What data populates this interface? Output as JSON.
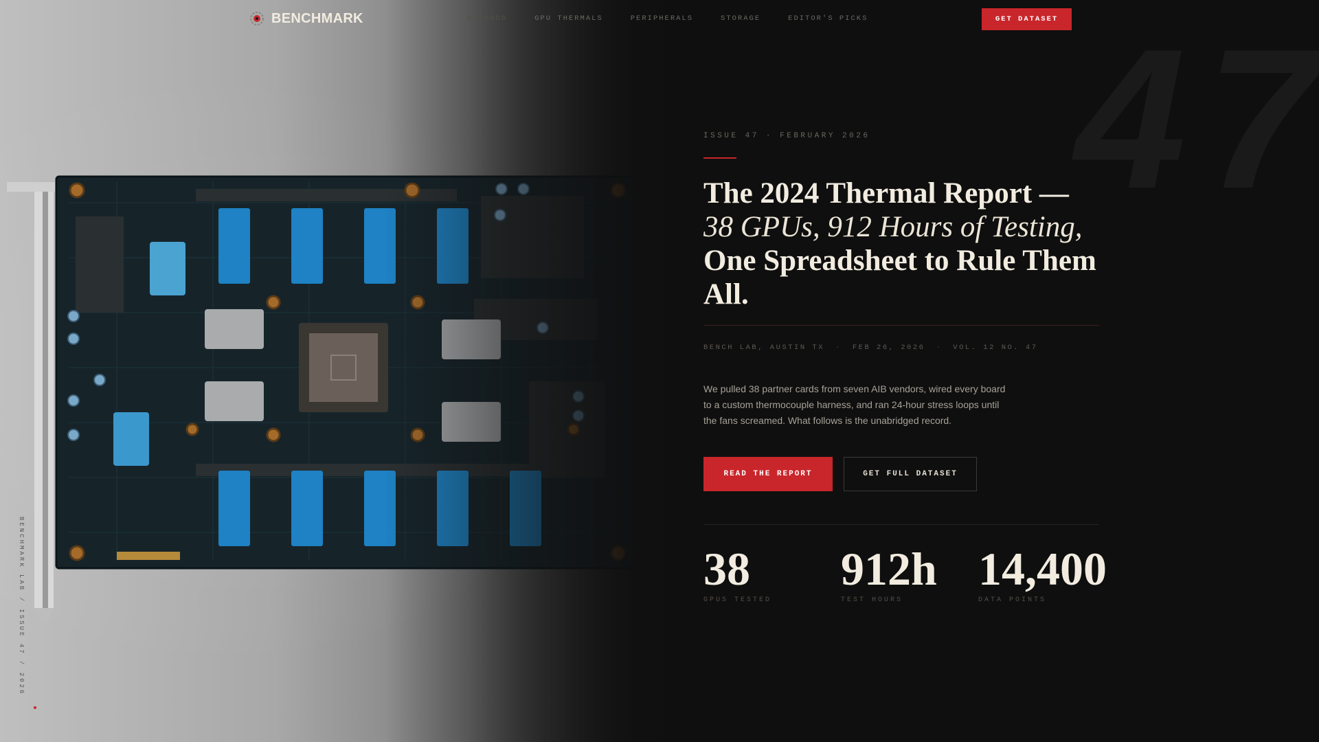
{
  "brand": {
    "name": "BENCHMARK",
    "logo_icon": "gear-chip-icon"
  },
  "nav": {
    "links": [
      "Methods",
      "GPU Thermals",
      "Peripherals",
      "Storage",
      "Editor's Picks"
    ],
    "cta_label": "Get Dataset"
  },
  "watermark": "47",
  "hero": {
    "kicker": "Issue 47 · February 2026",
    "headline_line1": "The 2024 Thermal Report —",
    "headline_line2": "38 GPUs, 912 Hours of Testing,",
    "headline_line3": "One Spreadsheet to Rule Them All.",
    "meta": [
      "Bench Lab, Austin TX",
      "Feb 26, 2026",
      "Vol. 12 No. 47"
    ],
    "meta_separator": "·",
    "lead": "We pulled 38 partner cards from seven AIB vendors, wired every board to a custom thermocouple harness, and ran 24-hour stress loops until the fans screamed. What follows is the unabridged record.",
    "primary_button": "Read the Report",
    "secondary_button": "Get Full Dataset"
  },
  "stats": [
    {
      "value": "38",
      "label": "GPUs Tested"
    },
    {
      "value": "912h",
      "label": "Test Hours"
    },
    {
      "value": "14,400",
      "label": "Data Points"
    }
  ],
  "image": {
    "subject": "gpu-circuit-board",
    "side_caption": "Benchmark Lab / Issue 47 / 2026"
  },
  "colors": {
    "accent": "#c9262b",
    "background": "#0f0f0f",
    "text": "#f2ece0",
    "muted": "#6b675f"
  }
}
